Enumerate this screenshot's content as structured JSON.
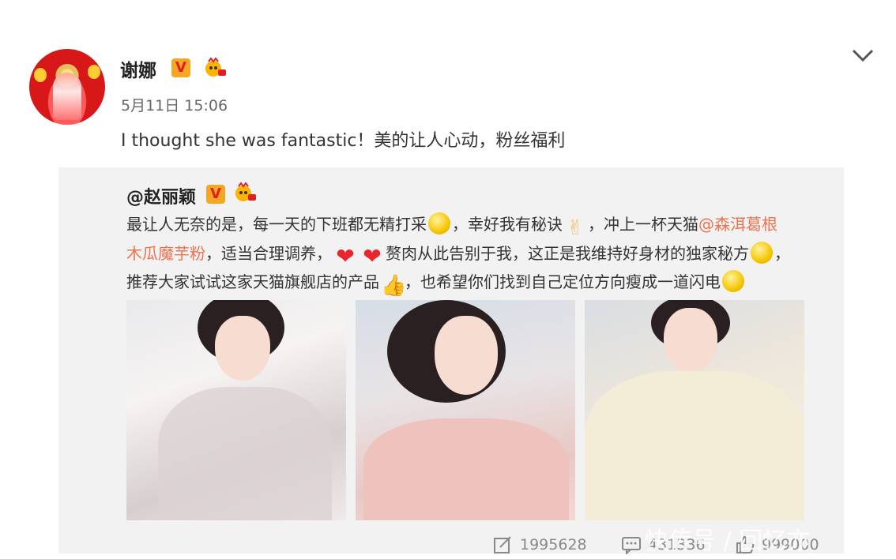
{
  "post": {
    "author": "谢娜",
    "date": "5月11日 15:06",
    "text": "I thought she was fantastic！美的让人心动，粉丝福利"
  },
  "repost": {
    "author": "@赵丽颖",
    "line1_a": "最让人无奈的是，每一天的下班都无精打采",
    "line1_b": "，幸好我有秘诀",
    "line1_c": "，冲上一杯天猫",
    "link1": "@森洱葛根",
    "link2": "木瓜魔芋粉",
    "line2_a": "，适当合理调养，",
    "line2_b": "赘肉从此告别于我，这正是我维持好身材的独家秘方",
    "line2_c": "，",
    "line3_a": "推荐大家试试这家天猫旗舰店的产品",
    "line3_b": "，也希望你们找到自己定位方向瘦成一道闪电"
  },
  "stats": {
    "reposts": "1995628",
    "comments": "431336",
    "likes": "999000"
  },
  "watermark": "快传号 / 回忆亦"
}
